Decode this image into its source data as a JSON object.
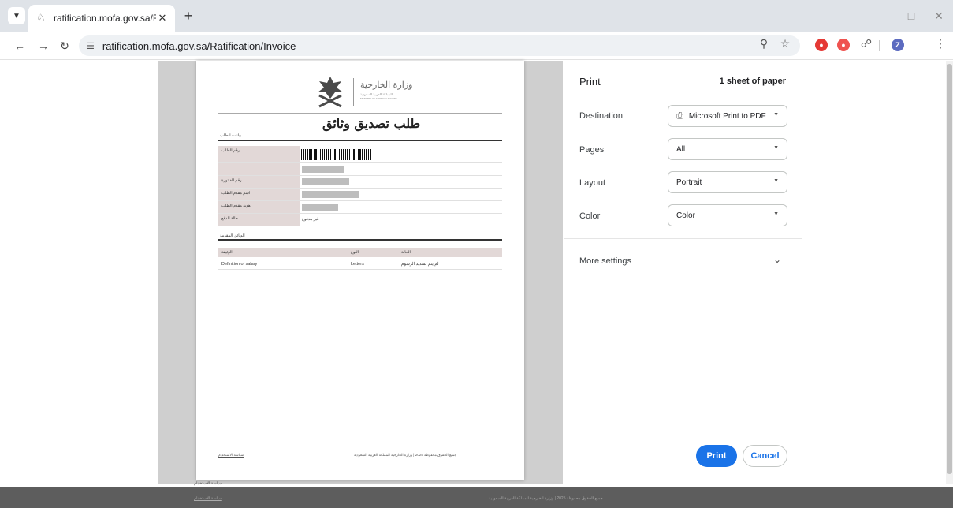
{
  "browser": {
    "tab_title": "ratification.mofa.gov.sa/Ratifica",
    "url": "ratification.mofa.gov.sa/Ratification/Invoice",
    "profile_initial": "Z"
  },
  "document": {
    "ministry_name_ar": "وزارة الخارجية",
    "ministry_sub_ar": "المملكة العربية السعودية",
    "ministry_sub_en": "MINISTRY OF FOREIGN AFFAIRS",
    "title": "طلب تصديق وثائق",
    "section_applicant": "بيانات الطلب",
    "rows": [
      {
        "label": "رقم الطلب"
      },
      {
        "label": ""
      },
      {
        "label": "رقم الفاتورة"
      },
      {
        "label": "اسم مقدم الطلب"
      },
      {
        "label": "هوية مقدم الطلب"
      },
      {
        "label": "حالة الدفع",
        "value": "غير مدفوع"
      }
    ],
    "section_docs": "الوثائق المقدمة",
    "docs_header": {
      "document": "الوثيقة",
      "type": "النوع",
      "status": "الحالة"
    },
    "docs_rows": [
      {
        "document": "Definition of salary",
        "type": "Letters",
        "status": "لم يتم تسديد الرسوم"
      }
    ],
    "footer_left": "سياسة الاستخدام",
    "footer_right": "جميع الحقوق محفوظة 2025 | وزارة الخارجية المملكة العربية السعودية"
  },
  "print_panel": {
    "title": "Print",
    "sheets": "1 sheet of paper",
    "destination_label": "Destination",
    "destination_value": "Microsoft Print to PDF",
    "pages_label": "Pages",
    "pages_value": "All",
    "layout_label": "Layout",
    "layout_value": "Portrait",
    "color_label": "Color",
    "color_value": "Color",
    "more_settings": "More settings",
    "print_button": "Print",
    "cancel_button": "Cancel"
  },
  "page_footer": {
    "left": "سياسة الاستخدام",
    "right": "جميع الحقوق محفوظة 2025 | وزارة الخارجية المملكة العربية السعودية",
    "under_sheet": "سياسة الاستخدام"
  },
  "colors": {
    "accent": "#1a73e8",
    "table_header": "#e2d8d7",
    "ext_red": "#e53935",
    "profile": "#5c6bc0"
  }
}
